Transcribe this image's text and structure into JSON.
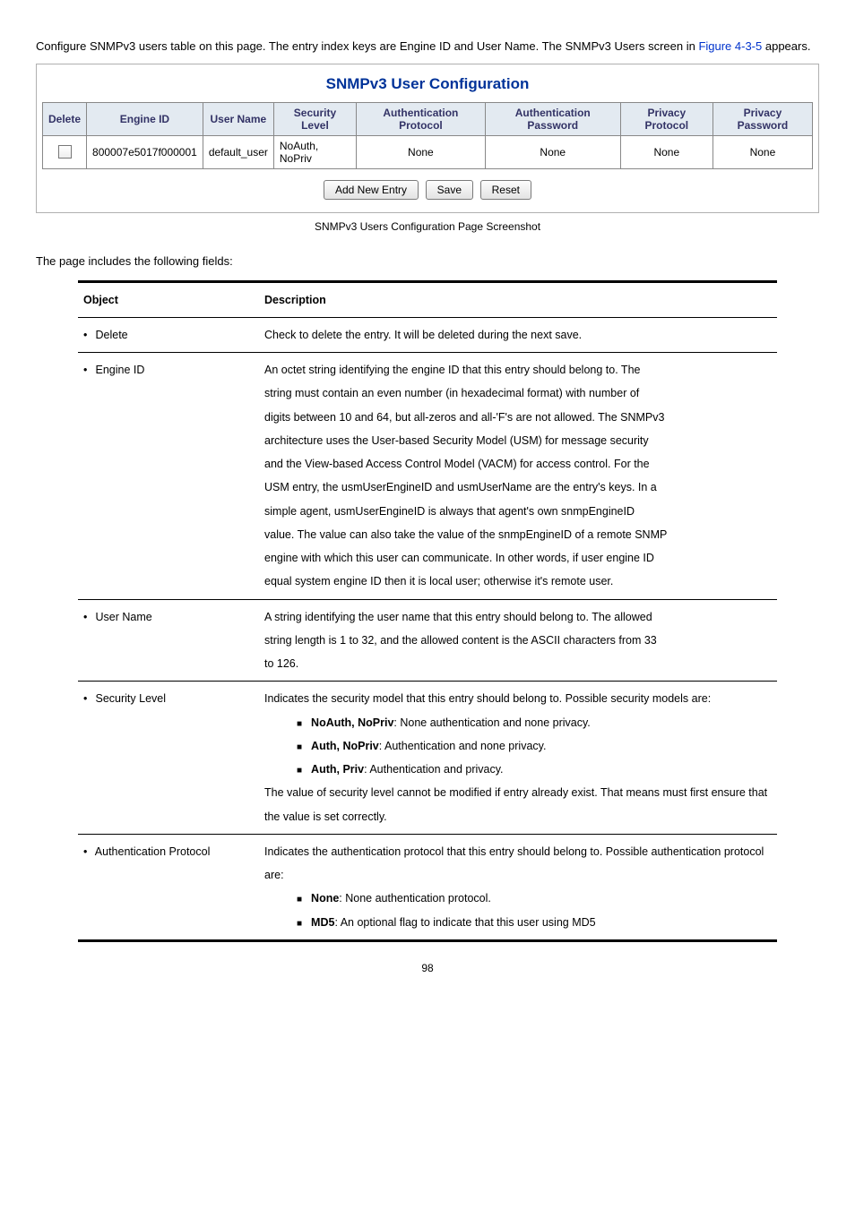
{
  "intro_before": "Configure SNMPv3 users table on this page. The entry index keys are Engine ID and User Name. The SNMPv3 Users screen in ",
  "intro_link": "Figure 4-3-5",
  "intro_after": " appears.",
  "panel": {
    "title": "SNMPv3 User Configuration",
    "headers": {
      "delete": "Delete",
      "engine_id": "Engine ID",
      "user_name": "User Name",
      "security_level": "Security Level",
      "auth_protocol": "Authentication Protocol",
      "auth_password": "Authentication Password",
      "priv_protocol": "Privacy Protocol",
      "priv_password": "Privacy Password"
    },
    "row": {
      "engine_id": "800007e5017f000001",
      "user_name": "default_user",
      "security_level": "NoAuth, NoPriv",
      "auth_protocol": "None",
      "auth_password": "None",
      "priv_protocol": "None",
      "priv_password": "None"
    },
    "buttons": {
      "add": "Add New Entry",
      "save": "Save",
      "reset": "Reset"
    }
  },
  "caption": "SNMPv3 Users Configuration Page Screenshot",
  "fields_intro": "The page includes the following fields:",
  "fields_header": {
    "object": "Object",
    "description": "Description"
  },
  "fields": {
    "delete": {
      "label": "Delete",
      "desc": "Check to delete the entry. It will be deleted during the next save."
    },
    "engine_id": {
      "label": "Engine ID",
      "lines": [
        "An octet string identifying the engine ID that this entry should belong to. The",
        "string must contain an even number (in hexadecimal format) with number of",
        "digits between 10 and 64, but all-zeros and all-'F's are not allowed. The SNMPv3",
        "architecture uses the User-based Security Model (USM) for message security",
        "and the View-based Access Control Model (VACM) for access control. For the",
        "USM entry, the usmUserEngineID and usmUserName are the entry's keys. In a",
        "simple agent, usmUserEngineID is always that agent's own snmpEngineID",
        "value. The value can also take the value of the snmpEngineID of a remote SNMP",
        "engine with which this user can communicate. In other words, if user engine ID",
        "equal system engine ID then it is local user; otherwise it's remote user."
      ]
    },
    "user_name": {
      "label": "User Name",
      "lines": [
        "A string identifying the user name that this entry should belong to. The allowed",
        "string length is 1 to 32, and the allowed content is the ASCII characters from 33",
        "to 126."
      ]
    },
    "security_level": {
      "label": "Security Level",
      "intro": "Indicates the security model that this entry should belong to. Possible security models are:",
      "items": [
        {
          "term": "NoAuth, NoPriv",
          "text": ": None authentication and none privacy."
        },
        {
          "term": "Auth, NoPriv",
          "text": ": Authentication and none privacy."
        },
        {
          "term": "Auth, Priv",
          "text": ": Authentication and privacy."
        }
      ],
      "outro": "The value of security level cannot be modified if entry already exist. That means must first ensure that the value is set correctly."
    },
    "auth_protocol": {
      "label": "Authentication Protocol",
      "intro": "Indicates the authentication protocol that this entry should belong to. Possible authentication protocol are:",
      "items": [
        {
          "term": "None",
          "text": ": None authentication protocol."
        },
        {
          "term": "MD5",
          "text": ": An optional flag to indicate that this user using MD5"
        }
      ]
    }
  },
  "page_no": "98"
}
